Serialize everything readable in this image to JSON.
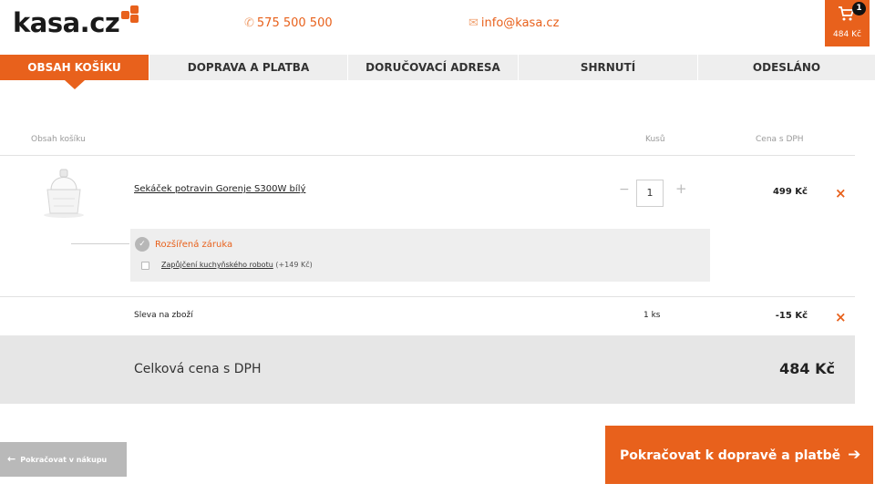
{
  "header": {
    "logo": "kasa.cz",
    "phone": "575 500 500",
    "email": "info@kasa.cz",
    "cart": {
      "count": "1",
      "total": "484 Kč"
    }
  },
  "steps": [
    {
      "label": "OBSAH KOŠÍKU",
      "active": true
    },
    {
      "label": "DOPRAVA A PLATBA",
      "active": false
    },
    {
      "label": "DORUČOVACÍ ADRESA",
      "active": false
    },
    {
      "label": "SHRNUTÍ",
      "active": false
    },
    {
      "label": "ODESLÁNO",
      "active": false
    }
  ],
  "table": {
    "col_content": "Obsah košíku",
    "col_qty": "Kusů",
    "col_price": "Cena s DPH"
  },
  "product": {
    "name": "Sekáček potravin Gorenje S300W bílý",
    "qty": "1",
    "minus": "−",
    "plus": "+",
    "price": "499 Kč"
  },
  "warranty": {
    "title": "Rozšířená záruka",
    "option_link": "Zapůjčení kuchyňského robotu",
    "option_extra": "(+149 Kč)"
  },
  "discount": {
    "label": "Sleva na zboží",
    "qty": "1 ks",
    "price": "-15 Kč"
  },
  "total": {
    "label": "Celková cena s DPH",
    "value": "484 Kč"
  },
  "buttons": {
    "back": "Pokračovat v nákupu",
    "next": "Pokračovat k dopravě a platbě"
  },
  "icons": {
    "remove": "×",
    "arrow_left": "←",
    "arrow_right": "➔"
  },
  "colors": {
    "accent": "#e8611c",
    "panel": "#eeeeee",
    "total_bg": "#e6e6e6",
    "back_button": "#b9b9b9"
  }
}
